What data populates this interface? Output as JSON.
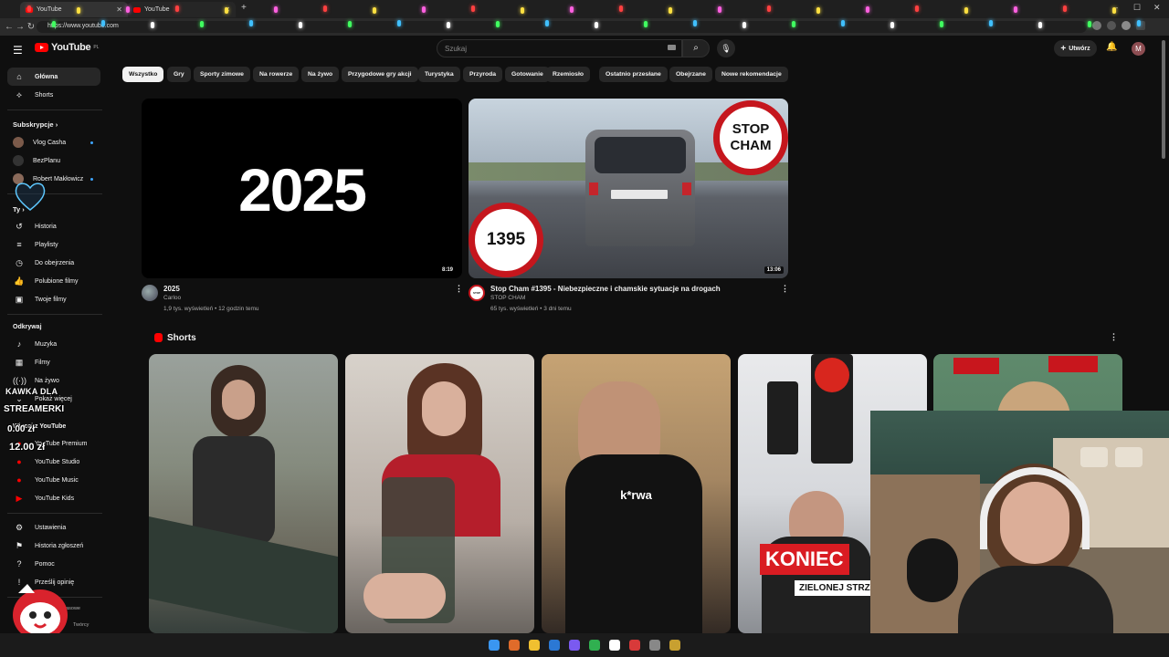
{
  "browser": {
    "tabs": [
      {
        "title": "YouTube"
      },
      {
        "title": "YouTube"
      }
    ],
    "url": "https://www.youtube.com",
    "new_tab": "+",
    "window_controls": [
      "–",
      "☐",
      "✕"
    ]
  },
  "header": {
    "logo_text": "YouTube",
    "logo_region": "PL",
    "search_placeholder": "Szukaj",
    "search_icon": "search-icon",
    "mic_icon": "mic-icon",
    "create_label": "Utwórz",
    "bell_icon": "bell-icon",
    "avatar_letter": "M"
  },
  "sidebar": {
    "main": [
      {
        "label": "Główna",
        "icon": "home-icon"
      },
      {
        "label": "Shorts",
        "icon": "shorts-icon"
      }
    ],
    "subs_heading": "Subskrypcje",
    "subs_chevron": "›",
    "subscriptions": [
      {
        "label": "Vlog Casha",
        "color": "#7b5a4a"
      },
      {
        "label": "BezPlanu",
        "color": "#333333"
      },
      {
        "label": "Robert Makłowicz",
        "color": "#8a6a5a"
      }
    ],
    "you_heading": "Ty",
    "you_chevron": "›",
    "you": [
      {
        "label": "Historia",
        "icon": "history-icon"
      },
      {
        "label": "Playlisty",
        "icon": "playlist-icon"
      },
      {
        "label": "Do obejrzenia",
        "icon": "clock-icon"
      },
      {
        "label": "Polubione filmy",
        "icon": "thumbs-up-icon"
      },
      {
        "label": "Twoje filmy",
        "icon": "video-icon"
      }
    ],
    "explore_heading": "Odkrywaj",
    "explore": [
      {
        "label": "Muzyka",
        "icon": "music-icon"
      },
      {
        "label": "Filmy",
        "icon": "film-icon"
      },
      {
        "label": "Na żywo",
        "icon": "live-icon"
      },
      {
        "label": "Pokaż więcej",
        "icon": "chevron-down-icon"
      }
    ],
    "more_heading": "Więcej z YouTube",
    "more": [
      {
        "label": "YouTube Premium"
      },
      {
        "label": "YouTube Studio"
      },
      {
        "label": "YouTube Music"
      },
      {
        "label": "YouTube Kids"
      }
    ],
    "settings": [
      {
        "label": "Ustawienia",
        "icon": "gear-icon"
      },
      {
        "label": "Historia zgłoszeń",
        "icon": "flag-icon"
      },
      {
        "label": "Pomoc",
        "icon": "help-icon"
      },
      {
        "label": "Prześlij opinię",
        "icon": "feedback-icon"
      }
    ],
    "footer_links": [
      "Informacje prasowe",
      "Twórcy"
    ]
  },
  "chips": [
    "Wszystko",
    "Gry",
    "Sporty zimowe",
    "Na rowerze",
    "Na żywo",
    "Przygodowe gry akcji",
    "Turystyka",
    "Przyroda",
    "Gotowanie",
    "Rzemiosło",
    "Ostatnio przesłane",
    "Obejrzane",
    "Nowe rekomendacje"
  ],
  "videos": [
    {
      "thumb_text": "2025",
      "duration": "8:19",
      "title": "2025",
      "channel": "Carloo",
      "meta": "1,9 tys. wyświetleń • 12 godzin temu"
    },
    {
      "thumb_badge_top": "STOP CHAM",
      "thumb_badge_num": "1395",
      "duration": "13:06",
      "title": "Stop Cham #1395 - Niebezpieczne i chamskie sytuacje na drogach",
      "channel": "STOP CHAM",
      "channel_avatar": "STOP CHAM",
      "meta": "65 tys. wyświetleń • 3 dni temu"
    }
  ],
  "shorts": {
    "heading": "Shorts",
    "items": [
      {
        "overlay": ""
      },
      {
        "overlay": ""
      },
      {
        "overlay": "k*rwa"
      },
      {
        "overlay_big": "KONIEC",
        "overlay_small": "ZIELONEJ STRZ"
      },
      {
        "overlay": ""
      }
    ]
  },
  "stream_overlay": {
    "title_line1": "KAWKA DLA",
    "title_line2": "STREAMERKI",
    "current": "0.00 zł",
    "goal": "12.00 zł"
  }
}
